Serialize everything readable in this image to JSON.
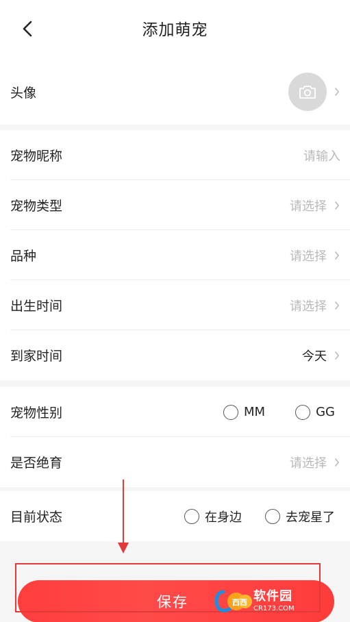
{
  "header": {
    "title": "添加萌宠"
  },
  "form": {
    "avatar": {
      "label": "头像"
    },
    "nickname": {
      "label": "宠物昵称",
      "placeholder": "请输入"
    },
    "type": {
      "label": "宠物类型",
      "placeholder": "请选择"
    },
    "breed": {
      "label": "品种",
      "placeholder": "请选择"
    },
    "birth": {
      "label": "出生时间",
      "placeholder": "请选择"
    },
    "arrival": {
      "label": "到家时间",
      "value": "今天"
    },
    "gender": {
      "label": "宠物性别",
      "options": [
        "MM",
        "GG"
      ]
    },
    "neutered": {
      "label": "是否绝育",
      "placeholder": "请选择"
    },
    "status": {
      "label": "目前状态",
      "options": [
        "在身边",
        "去宠星了"
      ]
    }
  },
  "save": {
    "label": "保存"
  },
  "watermark": {
    "name": "软件园",
    "url": "CR173.COM",
    "mark": "西西"
  },
  "colors": {
    "accent": "#ff3d3d",
    "annotation": "#e23a3a",
    "placeholder": "#b8b8b8"
  }
}
